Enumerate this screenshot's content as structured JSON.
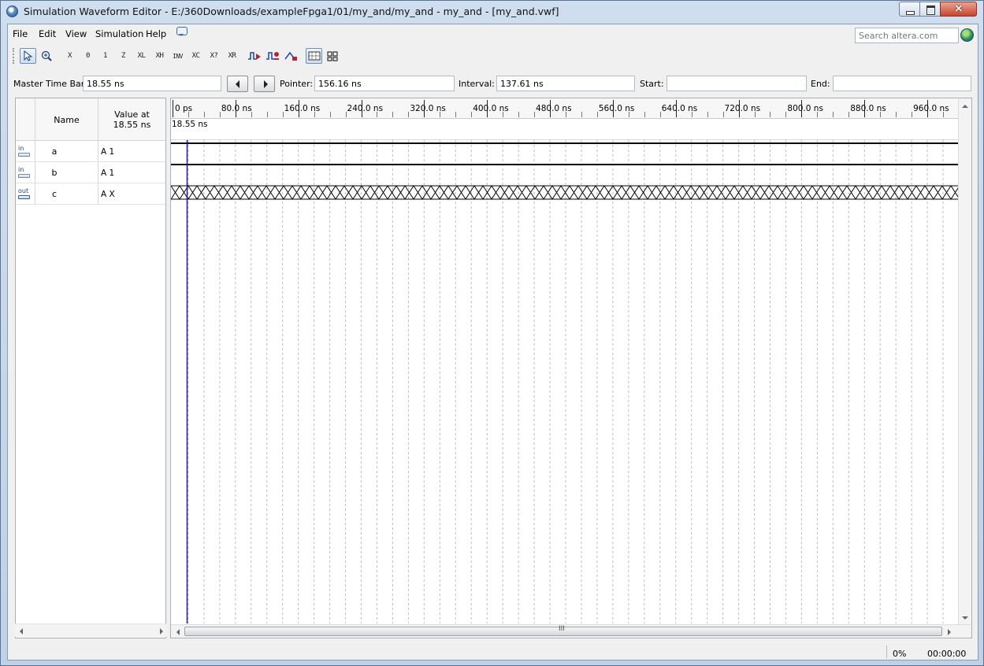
{
  "window": {
    "title": "Simulation Waveform Editor - E:/360Downloads/exampleFpga1/01/my_and/my_and - my_and - [my_and.vwf]",
    "close_glyph": "×"
  },
  "menu": {
    "file": "File",
    "edit": "Edit",
    "view": "View",
    "simulation": "Simulation",
    "help": "Help"
  },
  "search": {
    "placeholder": "Search altera.com"
  },
  "toolbar": {
    "icons": [
      "selection-tool-icon",
      "zoom-tool-icon",
      "forcing-unknown-icon",
      "forcing-low-icon",
      "forcing-high-icon",
      "high-impedance-icon",
      "weak-low-icon",
      "weak-high-icon",
      "invert-icon",
      "count-value-icon",
      "dont-care-icon",
      "random-values-icon",
      "run-functional-simulation-icon",
      "run-timing-simulation-icon",
      "generate-netlist-icon",
      "snap-to-grid-icon",
      "grid-icon"
    ],
    "glyphs": {
      "x": "X",
      "zero": "0",
      "one": "1",
      "z": "Z",
      "xl": "XL",
      "xh": "XH",
      "inv": "INV",
      "xc": "XC",
      "xq": "X?",
      "xr": "XR"
    }
  },
  "timebar": {
    "master_label": "Master Time Bar:",
    "master_value": "18.55 ns",
    "pointer_label": "Pointer:",
    "pointer_value": "156.16 ns",
    "interval_label": "Interval:",
    "interval_value": "137.61 ns",
    "start_label": "Start:",
    "start_value": "",
    "end_label": "End:",
    "end_value": ""
  },
  "signals_header": {
    "name": "Name",
    "value_line1": "Value at",
    "value_line2": "18.55 ns"
  },
  "signals": [
    {
      "direction": "in",
      "name": "a",
      "value": "A 1"
    },
    {
      "direction": "in",
      "name": "b",
      "value": "A 1"
    },
    {
      "direction": "out",
      "name": "c",
      "value": "A X"
    }
  ],
  "ruler": {
    "labels": [
      "0 ps",
      "80.0 ns",
      "160.0 ns",
      "240.0 ns",
      "320.0 ns",
      "400.0 ns",
      "480.0 ns",
      "560.0 ns",
      "640.0 ns",
      "720.0 ns",
      "800.0 ns",
      "880.0 ns",
      "960.0 ns"
    ],
    "cursor_label": "18.55 ns"
  },
  "chart_data": {
    "type": "waveform",
    "time_unit": "ns",
    "x_range": [
      0,
      1000
    ],
    "grid_interval": 20,
    "cursor_time": 18.55,
    "series": [
      {
        "name": "a",
        "level": "1"
      },
      {
        "name": "b",
        "level": "1"
      },
      {
        "name": "c",
        "level": "X"
      }
    ]
  },
  "hscroll": {
    "grip": "III"
  },
  "status": {
    "progress": "0%",
    "elapsed": "00:00:00"
  },
  "colors": {
    "cursor": "#1a1a8a",
    "grid": "#bcbcbc",
    "wave": "#000000",
    "window_frame": "#c9d9ea"
  }
}
